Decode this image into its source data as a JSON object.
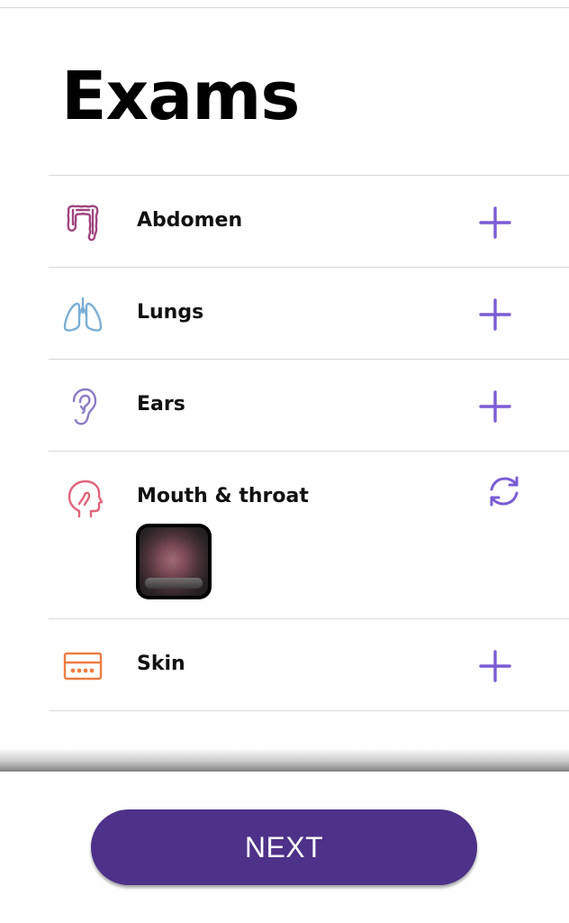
{
  "page": {
    "title": "Exams"
  },
  "colors": {
    "accent": "#7a5cd6",
    "button": "#4e3189",
    "abdomen": "#a0457f",
    "lungs": "#7aaed6",
    "ears": "#8a7cc8",
    "mouth": "#e0637a",
    "skin": "#ef7d43"
  },
  "exams": [
    {
      "label": "Abdomen",
      "icon": "intestine-icon",
      "action": "add-icon"
    },
    {
      "label": "Lungs",
      "icon": "lungs-icon",
      "action": "add-icon"
    },
    {
      "label": "Ears",
      "icon": "ear-icon",
      "action": "add-icon"
    },
    {
      "label": "Mouth & throat",
      "icon": "head-icon",
      "action": "retake-icon",
      "has_photo": true
    },
    {
      "label": "Skin",
      "icon": "skin-icon",
      "action": "add-icon"
    }
  ],
  "footer": {
    "next_label": "NEXT"
  }
}
